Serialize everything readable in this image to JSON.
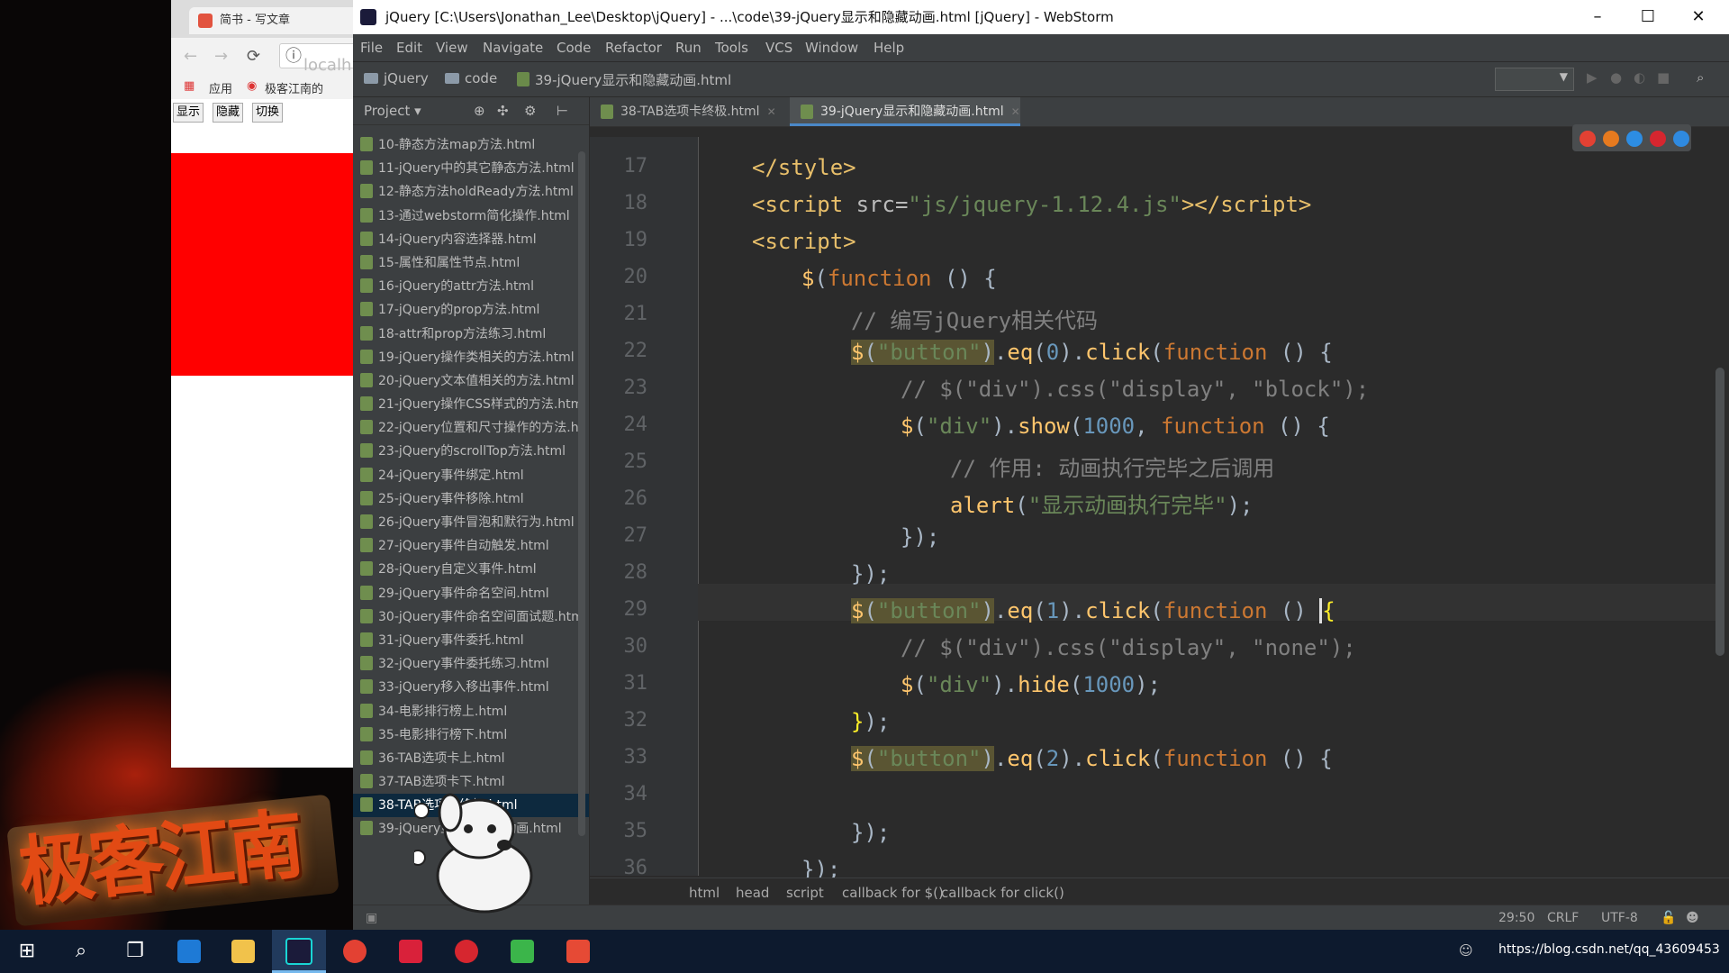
{
  "browser": {
    "tab_title": "简书 - 写文章",
    "address": "localh",
    "bookmarks": [
      "应用",
      "极客江南的"
    ],
    "buttons": [
      "显示",
      "隐藏",
      "切换"
    ]
  },
  "ide": {
    "window_title": "jQuery [C:\\Users\\Jonathan_Lee\\Desktop\\jQuery] - ...\\code\\39-jQuery显示和隐藏动画.html [jQuery] - WebStorm",
    "menu": [
      "File",
      "Edit",
      "View",
      "Navigate",
      "Code",
      "Refactor",
      "Run",
      "Tools",
      "VCS",
      "Window",
      "Help"
    ],
    "nav_crumbs": [
      "jQuery",
      "code",
      "39-jQuery显示和隐藏动画.html"
    ],
    "project_label": "Project",
    "project_files": [
      "10-静态方法map方法.html",
      "11-jQuery中的其它静态方法.html",
      "12-静态方法holdReady方法.html",
      "13-通过webstorm简化操作.html",
      "14-jQuery内容选择器.html",
      "15-属性和属性节点.html",
      "16-jQuery的attr方法.html",
      "17-jQuery的prop方法.html",
      "18-attr和prop方法练习.html",
      "19-jQuery操作类相关的方法.html",
      "20-jQuery文本值相关的方法.html",
      "21-jQuery操作CSS样式的方法.htm",
      "22-jQuery位置和尺寸操作的方法.h",
      "23-jQuery的scrollTop方法.html",
      "24-jQuery事件绑定.html",
      "25-jQuery事件移除.html",
      "26-jQuery事件冒泡和默行为.html",
      "27-jQuery事件自动触发.html",
      "28-jQuery自定义事件.html",
      "29-jQuery事件命名空间.html",
      "30-jQuery事件命名空间面试题.htm",
      "31-jQuery事件委托.html",
      "32-jQuery事件委托练习.html",
      "33-jQuery移入移出事件.html",
      "34-电影排行榜上.html",
      "35-电影排行榜下.html",
      "36-TAB选项卡上.html",
      "37-TAB选项卡下.html",
      "38-TAB选项卡终极.html",
      "39-jQuery显示和隐藏动画.html"
    ],
    "editor_tabs": [
      "38-TAB选项卡终极.html",
      "39-jQuery显示和隐藏动画.html"
    ],
    "line_numbers": [
      "17",
      "18",
      "19",
      "20",
      "21",
      "22",
      "23",
      "24",
      "25",
      "26",
      "27",
      "28",
      "29",
      "30",
      "31",
      "32",
      "33",
      "34",
      "35",
      "36"
    ],
    "breadcrumb": [
      "html",
      "head",
      "script",
      "callback for $()",
      "callback for click()"
    ],
    "status": {
      "position": "29:50",
      "line_sep": "CRLF",
      "encoding": "UTF-8"
    }
  },
  "taskbar": {
    "watermark_url": "https://blog.csdn.net/qq_43609453"
  },
  "colors": {
    "keyword": "#cc7832",
    "function": "#ffc66d",
    "string": "#6a8759",
    "number": "#6897bb",
    "comment": "#808080",
    "editor_bg": "#2b2b2b",
    "page_red": "#ff0000"
  }
}
